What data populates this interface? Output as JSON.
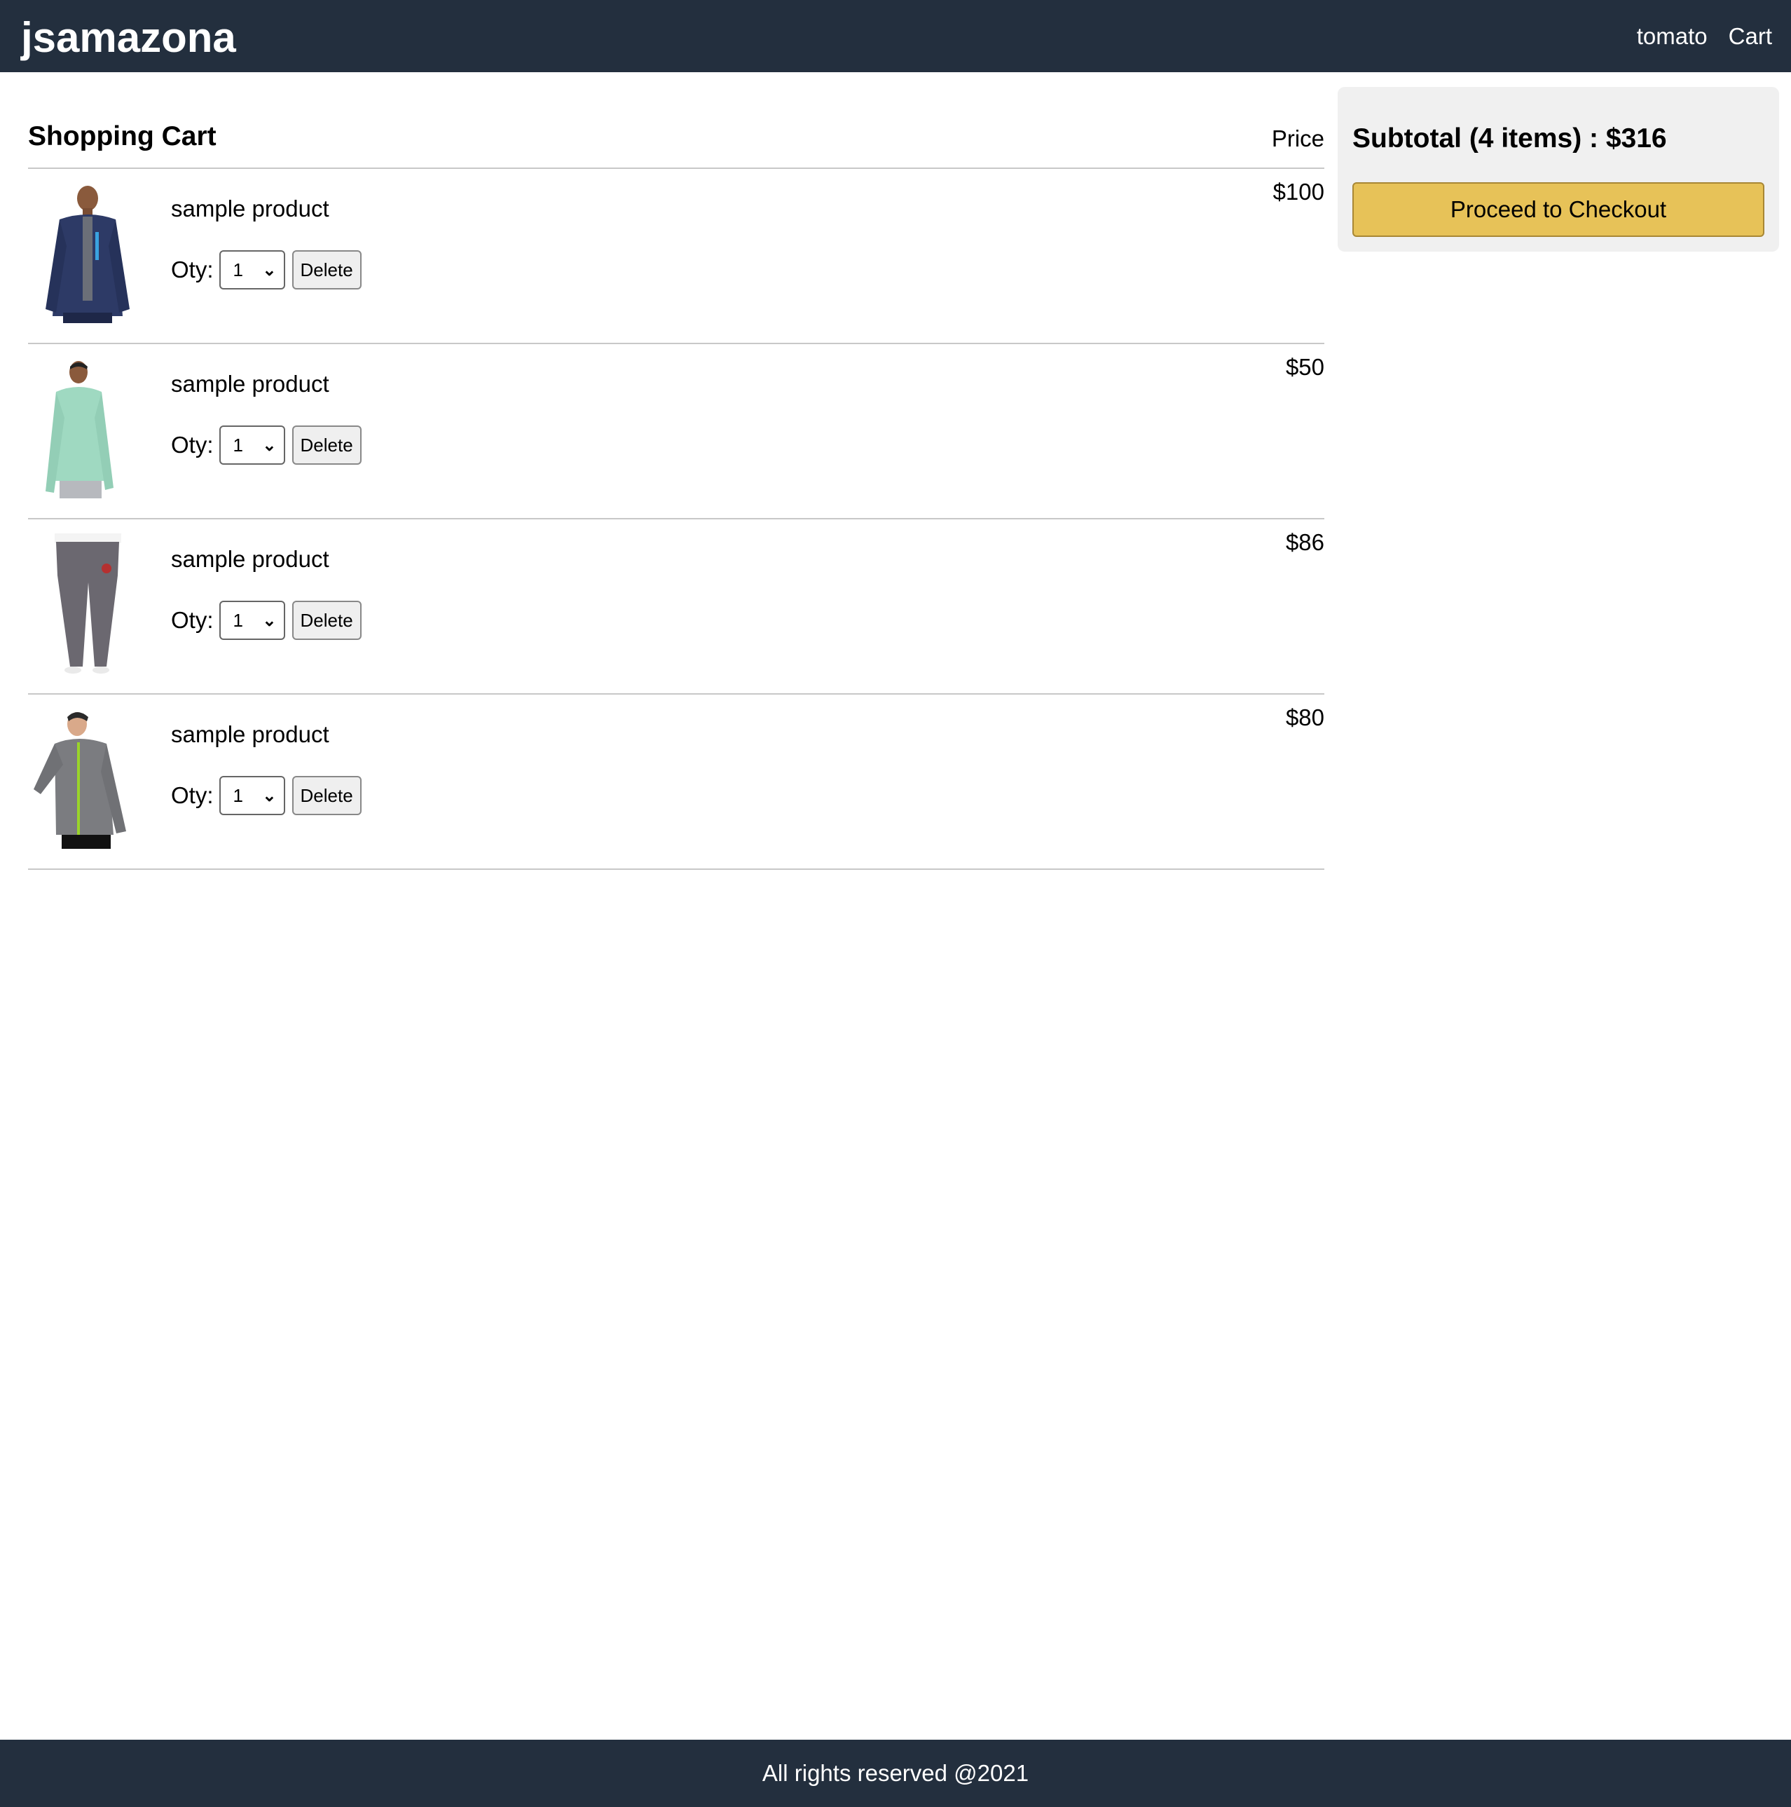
{
  "header": {
    "brand": "jsamazona",
    "nav": {
      "user": "tomato",
      "cart": "Cart"
    },
    "bg_color": "#232f3e"
  },
  "cart": {
    "title": "Shopping Cart",
    "price_header": "Price",
    "items": [
      {
        "name": "sample product",
        "qty_label": "Oty:",
        "qty": "1",
        "delete_label": "Delete",
        "price": "$100",
        "image": "man-navy-zip-hoodie"
      },
      {
        "name": "sample product",
        "qty_label": "Oty:",
        "qty": "1",
        "delete_label": "Delete",
        "price": "$50",
        "image": "man-mint-long-sleeve-shirt"
      },
      {
        "name": "sample product",
        "qty_label": "Oty:",
        "qty": "1",
        "delete_label": "Delete",
        "price": "$86",
        "image": "grey-jogger-pants"
      },
      {
        "name": "sample product",
        "qty_label": "Oty:",
        "qty": "1",
        "delete_label": "Delete",
        "price": "$80",
        "image": "man-grey-track-jacket"
      }
    ]
  },
  "summary": {
    "subtotal": "Subtotal (4 items) : $316",
    "checkout_label": "Proceed to Checkout",
    "button_color": "#e7c258"
  },
  "footer": {
    "text": "All rights reserved @2021"
  }
}
